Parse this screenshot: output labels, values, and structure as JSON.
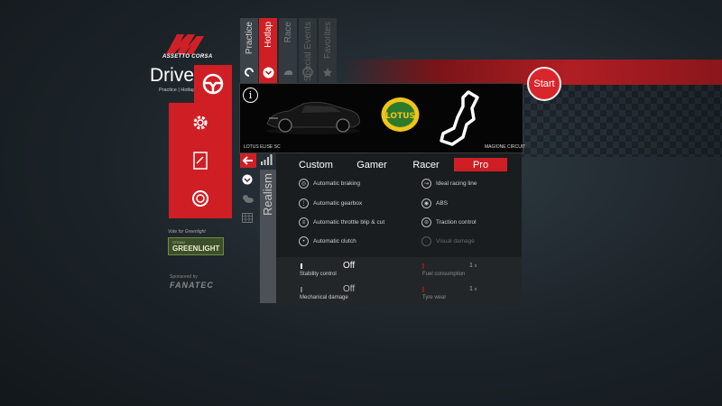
{
  "brand": {
    "line1": "ASSETTO CORSA"
  },
  "drive": {
    "title": "Drive",
    "subtitle": "Practice | Hotlap"
  },
  "tabs": [
    {
      "label": "Practice",
      "state": "inactive"
    },
    {
      "label": "Hotlap",
      "state": "active"
    },
    {
      "label": "Race",
      "state": "dim"
    },
    {
      "label": "Special Events",
      "state": "dim"
    },
    {
      "label": "Favorites",
      "state": "dim"
    }
  ],
  "start_label": "Start",
  "vote_text": "Vote for Greenlight",
  "greenlight": {
    "small": "STEAM",
    "big": "GREENLIGHT"
  },
  "sponsor": {
    "label": "Sponsored by",
    "name": "FANATEC"
  },
  "car_name": "LOTUS ELISE SC",
  "circuit_name": "MAGIONE CIRCUIT",
  "realism_label": "Realism",
  "presets": [
    {
      "label": "Custom"
    },
    {
      "label": "Gamer"
    },
    {
      "label": "Racer"
    },
    {
      "label": "Pro"
    }
  ],
  "options_left": [
    {
      "label": "Automatic braking",
      "icon": "brake-icon"
    },
    {
      "label": "Automatic gearbox",
      "icon": "gearbox-icon"
    },
    {
      "label": "Automatic throttle blip & cut",
      "icon": "throttle-icon"
    },
    {
      "label": "Automatic clutch",
      "icon": "clutch-icon"
    }
  ],
  "options_right": [
    {
      "label": "Ideal racing line",
      "icon": "racing-line-icon"
    },
    {
      "label": "ABS",
      "icon": "abs-icon"
    },
    {
      "label": "Traction control",
      "icon": "traction-icon"
    },
    {
      "label": "Visual damage",
      "icon": "visual-damage-icon"
    }
  ],
  "sliders": {
    "stability": {
      "label": "Stability control",
      "value": "Off"
    },
    "mechanical": {
      "label": "Mechanical damage",
      "value": "Off"
    },
    "fuel": {
      "label": "Fuel consumption",
      "value": "1",
      "unit": "x"
    },
    "tyre": {
      "label": "Tyre wear",
      "value": "1",
      "unit": "x"
    }
  },
  "colors": {
    "accent": "#cf1f25",
    "panel": "#191d20"
  }
}
